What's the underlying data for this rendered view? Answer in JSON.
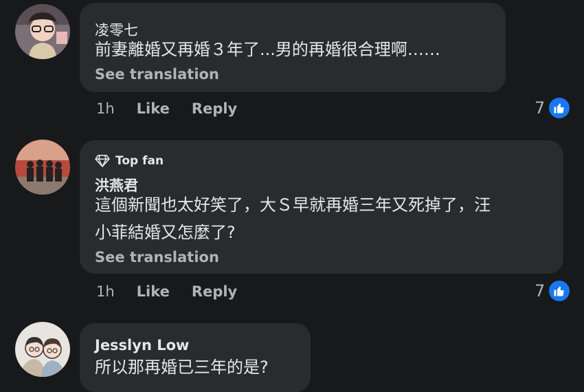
{
  "comments": [
    {
      "author": "凌零七",
      "text": "前妻離婚又再婚３年了...男的再婚很合理啊……",
      "see_translation": "See translation",
      "time": "1h",
      "like_label": "Like",
      "reply_label": "Reply",
      "reaction_count": "7",
      "reaction_icon": "like-icon",
      "accent": "#1877f2"
    },
    {
      "badge": "Top fan",
      "badge_icon": "diamond-icon",
      "author": "洪燕君",
      "text": "這個新聞也太好笑了，大Ｓ早就再婚三年又死掉了，汪\n小菲結婚又怎麼了?",
      "see_translation": "See translation",
      "time": "1h",
      "like_label": "Like",
      "reply_label": "Reply",
      "reaction_count": "7",
      "reaction_icon": "like-icon"
    },
    {
      "author": "Jesslyn Low",
      "text": "所以那再婚已三年的是?"
    }
  ]
}
